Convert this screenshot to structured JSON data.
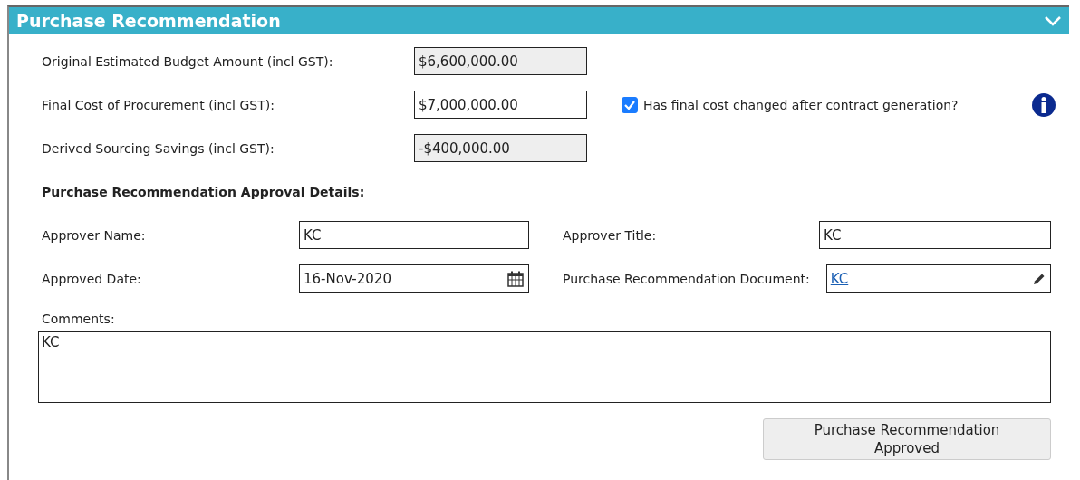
{
  "panel": {
    "title": "Purchase Recommendation",
    "expanded": true
  },
  "cost_fields": [
    {
      "label": "Original Estimated Budget Amount (incl GST):",
      "value": "$6,600,000.00",
      "readonly": true
    },
    {
      "label": "Final Cost of Procurement (incl GST):",
      "value": "$7,000,000.00",
      "readonly": false,
      "checkbox": {
        "label": "Has final cost changed after contract generation?",
        "checked": true
      }
    },
    {
      "label": "Derived Sourcing Savings (incl GST):",
      "value": "-$400,000.00",
      "readonly": true
    }
  ],
  "approval": {
    "heading": "Purchase Recommendation Approval Details:",
    "rows": [
      [
        {
          "label": "Approver Name:",
          "value": "KC",
          "kind": "text"
        },
        {
          "label": "Approver Title:",
          "value": "KC",
          "kind": "text"
        }
      ],
      [
        {
          "label": "Approved Date:",
          "value": "16-Nov-2020",
          "kind": "date"
        },
        {
          "label": "Purchase Recommendation Document:",
          "value": "KC",
          "kind": "document"
        }
      ]
    ],
    "comments_label": "Comments:",
    "comments": "KC"
  },
  "button": "Purchase Recommendation\nApproved"
}
